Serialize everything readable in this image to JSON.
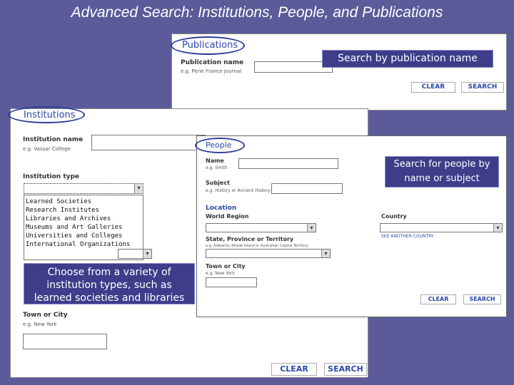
{
  "slide_title": "Advanced Search: Institutions, People, and Publications",
  "publications": {
    "header": "Publications",
    "field_label": "Publication name",
    "field_hint": "e.g. Pene Yrance Journal",
    "callout": "Search by publication name",
    "clear": "CLEAR",
    "search": "SEARCH"
  },
  "institutions": {
    "header": "Institutions",
    "name_label": "Institution name",
    "name_hint": "e.g. Vassar College",
    "type_label": "Institution type",
    "type_options": [
      "Learned Societies",
      "Research Institutes",
      "Libraries and Archives",
      "Museums and Art Galleries",
      "Universities and Colleges",
      "International Organizations"
    ],
    "callout": "Choose from a variety of institution types, such as learned societies and libraries",
    "town_label": "Town or City",
    "town_hint": "e.g. New York",
    "clear": "CLEAR",
    "search": "SEARCH"
  },
  "people": {
    "header": "People",
    "name_label": "Name",
    "name_hint": "e.g. Smith",
    "subject_label": "Subject",
    "subject_hint": "e.g. History or Ancient History",
    "callout": "Search for people by name or subject",
    "location_header": "Location",
    "region_label": "World Region",
    "country_label": "Country",
    "country_link": "SEE ANOTHER COUNTRY",
    "state_label": "State, Province or Territory",
    "state_hint": "e.g. Alabama, Rhode Island or Australian Capital Territory",
    "town_label": "Town or City",
    "town_hint": "e.g. New York",
    "clear": "CLEAR",
    "search": "SEARCH"
  }
}
